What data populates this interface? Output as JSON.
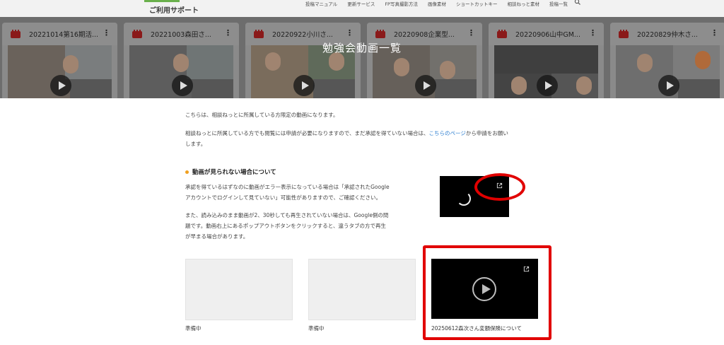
{
  "header": {
    "site_name": "ご利用サポート",
    "nav": [
      "投稿マニュアル",
      "更新サービス",
      "FP写真撮影方法",
      "画像素材",
      "ショートカットキー",
      "相談ねっと素材",
      "投稿一覧"
    ]
  },
  "hero": {
    "title": "勉強会動画一覧",
    "videos": [
      {
        "title": "20221014第16期活..."
      },
      {
        "title": "20221003森田さ..."
      },
      {
        "title": "20220922小川さ..."
      },
      {
        "title": "20220908企業型..."
      },
      {
        "title": "20220906山中GM..."
      },
      {
        "title": "20220829仲木さ..."
      }
    ]
  },
  "main": {
    "intro": "こちらは、相談ねっとに所属している方限定の動画になります。",
    "access_pre": "相談ねっとに所属している方でも閲覧には申請が必要になりますので、まだ承認を得ていない場合は、",
    "access_link": "こちらのページ",
    "access_post1": "から申請をお願い",
    "access_post2": "します。",
    "trouble_heading": "動画が見られない場合について",
    "trouble_p1_line1": "承認を得ているはずなのに動画がエラー表示になっている場合は「承認されたGoogle",
    "trouble_p1_line2": "アカウントでログインして見ていない」可能性がありますので、ご確認ください。",
    "trouble_p2_line1": "また、読み込みのまま動画が2、30秒しても再生されていない場合は、Google側の問",
    "trouble_p2_line2": "題です。動画右上にあるポップアウトボタンをクリックすると、違うタブの方で再生",
    "trouble_p2_line3": "が早まる場合があります。"
  },
  "cards": [
    {
      "label": "準備中"
    },
    {
      "label": "準備中"
    },
    {
      "label": "20250612森次さん変額保険について"
    }
  ],
  "colors": {
    "highlight": "#e10000",
    "link": "#2e7fd1",
    "bullet": "#f0a020"
  }
}
